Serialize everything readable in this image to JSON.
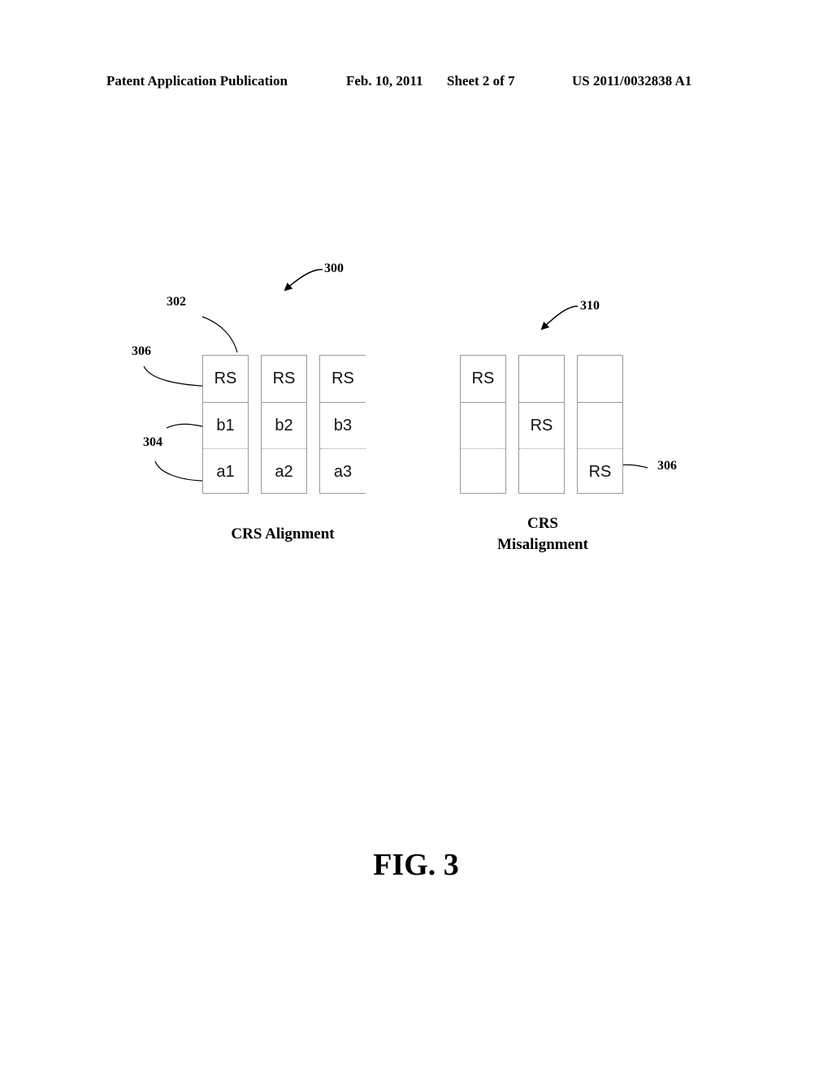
{
  "header": {
    "publication": "Patent Application Publication",
    "date": "Feb. 10, 2011",
    "sheet": "Sheet 2 of 7",
    "number": "US 2011/0032838 A1"
  },
  "figure_label": "FIG. 3",
  "left_diagram": {
    "ref": "300",
    "caption": "CRS Alignment",
    "callouts": {
      "c302": "302",
      "c306": "306",
      "c304": "304"
    },
    "columns": [
      {
        "cells": [
          "RS",
          "b1",
          "a1"
        ]
      },
      {
        "cells": [
          "RS",
          "b2",
          "a2"
        ]
      },
      {
        "cells": [
          "RS",
          "b3",
          "a3"
        ]
      }
    ]
  },
  "right_diagram": {
    "ref": "310",
    "caption_line1": "CRS",
    "caption_line2": "Misalignment",
    "callouts": {
      "c306": "306"
    },
    "columns": [
      {
        "cells": [
          "RS",
          "",
          ""
        ]
      },
      {
        "cells": [
          "",
          "RS",
          ""
        ]
      },
      {
        "cells": [
          "",
          "",
          "RS"
        ]
      }
    ]
  }
}
